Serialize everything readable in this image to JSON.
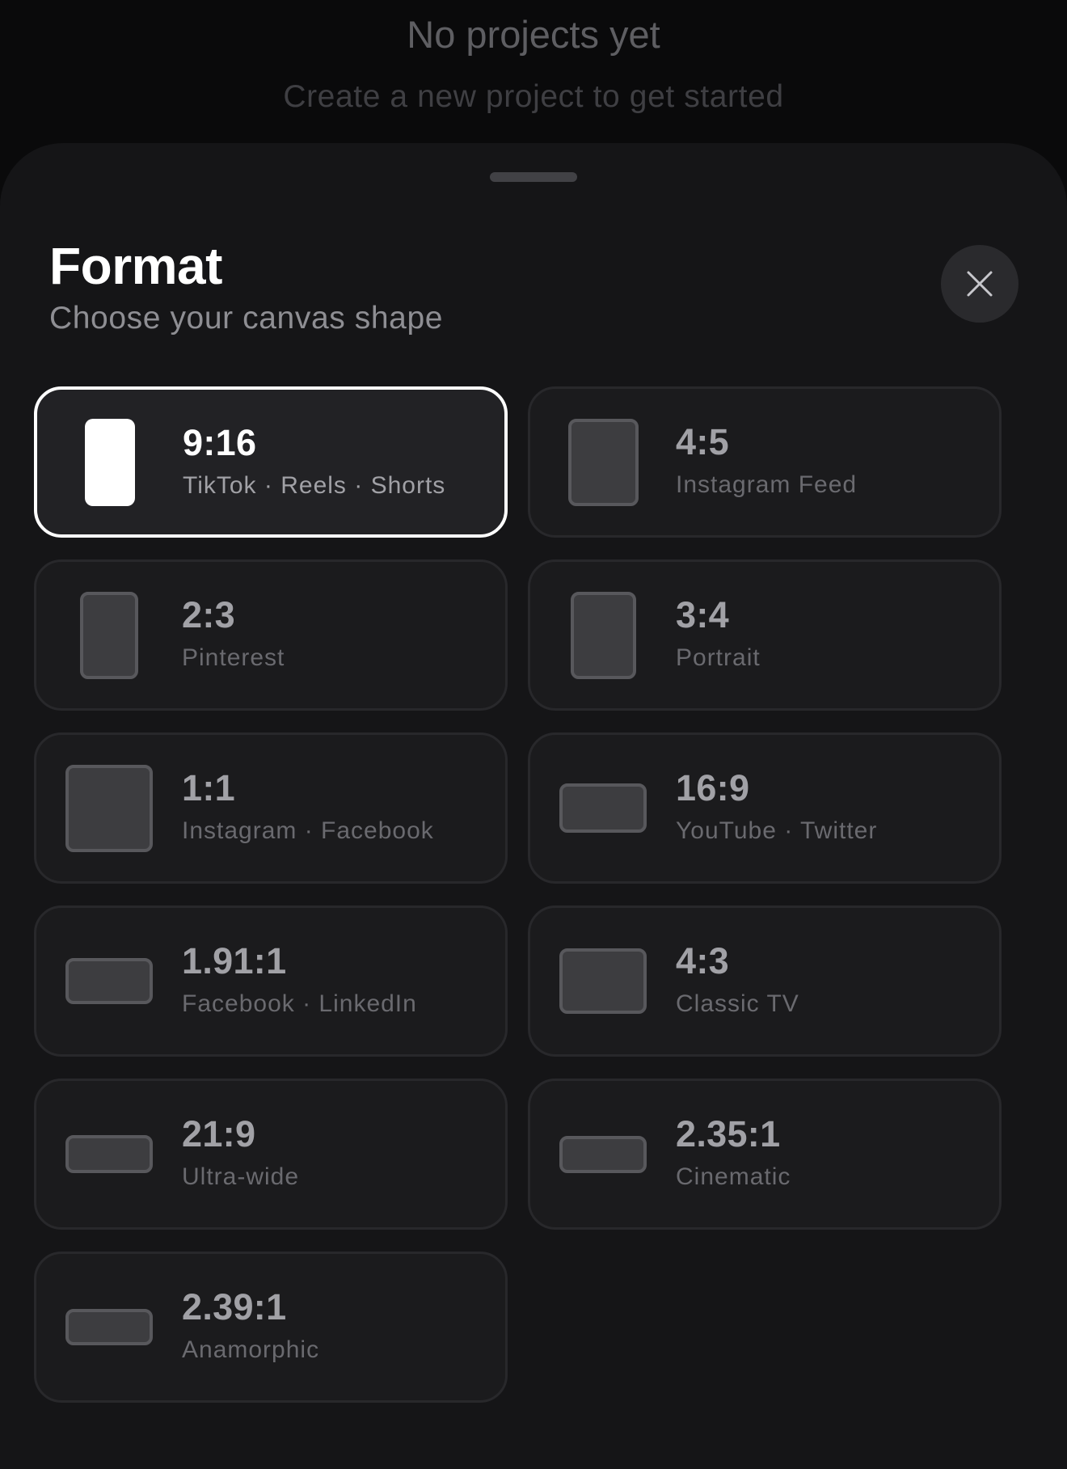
{
  "background": {
    "empty_title": "No projects yet",
    "empty_subtitle": "Create a new project to get started"
  },
  "sheet": {
    "title": "Format",
    "subtitle": "Choose your canvas shape",
    "close_icon": "close-icon",
    "formats": [
      {
        "ratio": "9:16",
        "platforms": "TikTok · Reels · Shorts",
        "selected": true
      },
      {
        "ratio": "4:5",
        "platforms": "Instagram Feed",
        "selected": false
      },
      {
        "ratio": "2:3",
        "platforms": "Pinterest",
        "selected": false
      },
      {
        "ratio": "3:4",
        "platforms": "Portrait",
        "selected": false
      },
      {
        "ratio": "1:1",
        "platforms": "Instagram · Facebook",
        "selected": false
      },
      {
        "ratio": "16:9",
        "platforms": "YouTube · Twitter",
        "selected": false
      },
      {
        "ratio": "1.91:1",
        "platforms": "Facebook · LinkedIn",
        "selected": false
      },
      {
        "ratio": "4:3",
        "platforms": "Classic TV",
        "selected": false
      },
      {
        "ratio": "21:9",
        "platforms": "Ultra-wide",
        "selected": false
      },
      {
        "ratio": "2.35:1",
        "platforms": "Cinematic",
        "selected": false
      },
      {
        "ratio": "2.39:1",
        "platforms": "Anamorphic",
        "selected": false
      }
    ]
  },
  "colors": {
    "background": "#0a0a0b",
    "sheet": "#151517",
    "card": "#1b1b1d",
    "selected_border": "#ffffff",
    "thumb_fill": "#3d3d40"
  }
}
